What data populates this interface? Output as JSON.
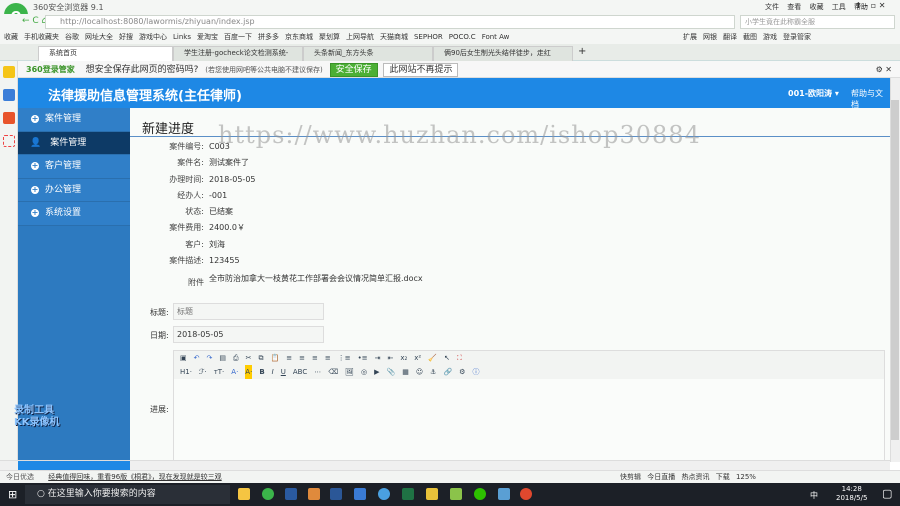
{
  "browser": {
    "title": "360安全浏览器 9.1",
    "menu": [
      "文件",
      "查看",
      "收藏",
      "工具",
      "帮助"
    ],
    "url": "http://localhost:8080/lawormis/zhiyuan/index.jsp",
    "search_placeholder": "小学生竟在此称霸全服",
    "bookmarks": [
      "收藏",
      "手机收藏夹",
      "谷歌",
      "网址大全",
      "好搜",
      "游戏中心",
      "Links",
      "爱淘宝",
      "百度一下",
      "拼多多",
      "京东商城",
      "聚划算",
      "上网导航",
      "天猫商城",
      "SEPHOR",
      "POCO.C",
      "Font Aw"
    ],
    "bookmarks_right": [
      "扩展",
      "网银",
      "翻译",
      "截图",
      "游戏",
      "登录管家"
    ],
    "tabs": [
      "系统首页",
      "学生注册-gocheck论文检测系统-",
      "头条新闻_东方头条",
      "俩90后女生制光头结伴徒步，走红"
    ],
    "password_bar": {
      "brand": "360登录管家",
      "question": "想安全保存此网页的密码吗?",
      "hint": "(若您使用网吧等公共电脑不建议保存)",
      "save": "安全保存",
      "never": "此网站不再提示"
    }
  },
  "app": {
    "title": "法律援助信息管理系统(主任律师)",
    "user": "001-欧阳涛",
    "help": "帮助与文档",
    "sidebar": [
      "案件管理",
      "案件管理",
      "客户管理",
      "办公管理",
      "系统设置"
    ],
    "page_title": "新建进度",
    "watermark": "https://www.huzhan.com/ishop30884",
    "details": [
      {
        "label": "案件编号:",
        "value": "C003"
      },
      {
        "label": "案件名:",
        "value": "测试案件了"
      },
      {
        "label": "办理时间:",
        "value": "2018-05-05"
      },
      {
        "label": "经办人:",
        "value": "-001"
      },
      {
        "label": "状态:",
        "value": "已结案"
      },
      {
        "label": "案件费用:",
        "value": "2400.0￥"
      },
      {
        "label": "客户:",
        "value": "刘海"
      },
      {
        "label": "案件描述:",
        "value": "123455"
      },
      {
        "label": "附件",
        "value": "全市防治加拿大一枝黄花工作部署会会议情况简单汇报.docx"
      }
    ],
    "form": {
      "title_label": "标题:",
      "title_placeholder": "标题",
      "date_label": "日期:",
      "date_value": "2018-05-05",
      "progress_label": "进展:"
    },
    "toolbar_row2": [
      "H1·",
      "ℱ·",
      "тT·",
      "A·",
      "A·",
      "B",
      "I",
      "U",
      "ABC"
    ]
  },
  "status": {
    "left": "今日优选",
    "news": "经典值得回味，重看96版《桐君》，现在发现就是较三观",
    "right": [
      "快剪辑",
      "今日直播",
      "热点资讯",
      "下载",
      "125%"
    ]
  },
  "taskbar": {
    "search": "在这里输入你要搜索的内容",
    "time": "14:28",
    "date": "2018/5/5",
    "ime": "中"
  },
  "recorder": [
    "录制工具",
    "KK录像机"
  ]
}
